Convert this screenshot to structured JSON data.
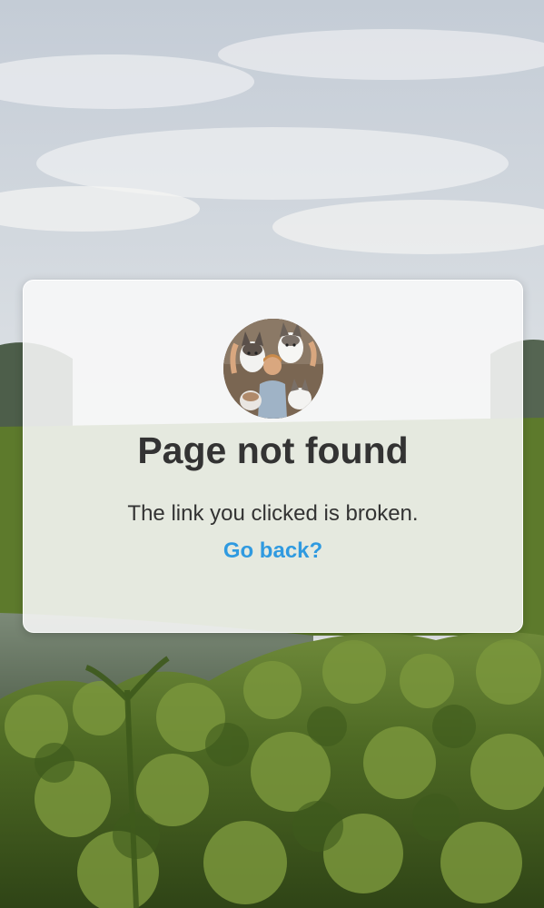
{
  "error": {
    "title": "Page not found",
    "message": "The link you clicked is broken.",
    "back_link": "Go back?"
  },
  "colors": {
    "title_text": "#333333",
    "message_text": "#333333",
    "link": "#2f9ae0",
    "card_background": "#f8f8f8"
  },
  "icons": {
    "avatar": "profile-photo-person-with-huskies"
  }
}
